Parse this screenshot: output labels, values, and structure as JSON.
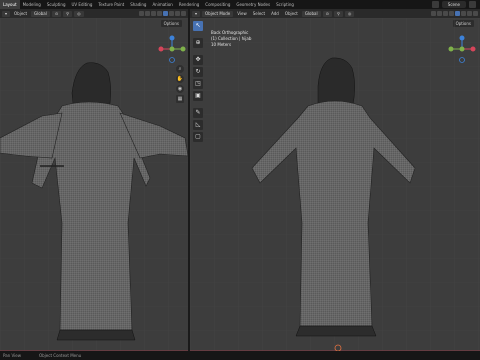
{
  "topbar": {
    "workspaces": [
      "Layout",
      "Modeling",
      "Sculpting",
      "UV Editing",
      "Texture Paint",
      "Shading",
      "Animation",
      "Rendering",
      "Compositing",
      "Geometry Nodes",
      "Scripting"
    ],
    "active_workspace": "Layout",
    "scene_name": "Scene"
  },
  "left_viewport": {
    "header": {
      "object_menu": "Object",
      "transform_orientation": "Global"
    },
    "options_label": "Options"
  },
  "right_viewport": {
    "header": {
      "mode": "Object Mode",
      "menus": [
        "View",
        "Select",
        "Add",
        "Object"
      ],
      "transform_orientation": "Global"
    },
    "options_label": "Options",
    "overlay": {
      "view_name": "Back Orthographic",
      "collection": "(1) Collection | hijab",
      "scale": "10 Meters"
    }
  },
  "statusbar": {
    "left": "Pan View",
    "right": "Object Context Menu"
  },
  "colors": {
    "viewport_bg": "#3d3d3d",
    "accent": "#4772b3",
    "axis_x": "#d6455a",
    "axis_y": "#7fb24a",
    "axis_z": "#3d82d9"
  }
}
